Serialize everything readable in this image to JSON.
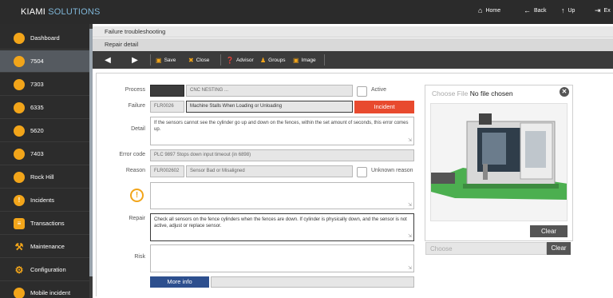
{
  "header": {
    "brand_main": "KIAMI",
    "brand_accent": "SOLUTIONS",
    "nav": [
      {
        "icon": "home-icon",
        "label": "Home"
      },
      {
        "icon": "back-icon",
        "label": "Back"
      },
      {
        "icon": "up-icon",
        "label": "Up"
      },
      {
        "icon": "exit-icon",
        "label": "Ex"
      }
    ]
  },
  "sidebar": {
    "items": [
      {
        "label": "Dashboard",
        "active": false
      },
      {
        "label": "7504",
        "active": true
      },
      {
        "label": "7303",
        "active": false
      },
      {
        "label": "6335",
        "active": false
      },
      {
        "label": "5620",
        "active": false
      },
      {
        "label": "7403",
        "active": false
      },
      {
        "label": "Rock Hill",
        "active": false
      },
      {
        "label": "Incidents",
        "active": false,
        "icon": "!"
      },
      {
        "label": "Transactions",
        "active": false
      },
      {
        "label": "Maintenance",
        "active": false
      },
      {
        "label": "Configuration",
        "active": false
      },
      {
        "label": "Mobile incident",
        "active": false
      }
    ]
  },
  "breadcrumb": {
    "level1": "Failure troubleshooting",
    "level2": "Repair detail"
  },
  "toolbar": {
    "save": "Save",
    "close": "Close",
    "advisor": "Advisor",
    "groups": "Groups",
    "image": "Image"
  },
  "form": {
    "process_label": "Process",
    "process_value": "CNC NESTING ...",
    "active_label": "Active",
    "failure_label": "Failure",
    "failure_code": "FLR0026",
    "failure_desc": "Machine Stalls When Loading or Unloading",
    "incident_button": "Incident",
    "detail_label": "Detail",
    "detail_text": "If the sensors cannot see the cylinder go up and down on the fences, within the set amount of seconds, this error comes up.",
    "errorcode_label": "Error code",
    "errorcode_value": "PLC 9897 Stops down input timeout (in 6898)",
    "reason_label": "Reason",
    "reason_code": "FLR002602",
    "reason_desc": "Sensor Bad or Misaligned",
    "unknown_reason_label": "Unknown reason",
    "idea_value": "",
    "repair_label": "Repair",
    "repair_text": "Check all sensors on the fence cylinders when the fences are down. If cylinder is physically down, and the sensor is not active, adjust or replace sensor.",
    "risk_label": "Risk",
    "risk_text": "",
    "more_info_button": "More info"
  },
  "image_panel": {
    "choose_file_button": "Choose File",
    "no_file_text": "No file chosen",
    "clear_button": "Clear",
    "choose_label": "Choose",
    "clear_button_2": "Clear"
  },
  "colors": {
    "topbar": "#2b2b2b",
    "sidebar": "#2c2c2c",
    "accent_orange": "#f2a51a",
    "incident_red": "#e84a2e",
    "more_info_blue": "#2d4f8e"
  }
}
